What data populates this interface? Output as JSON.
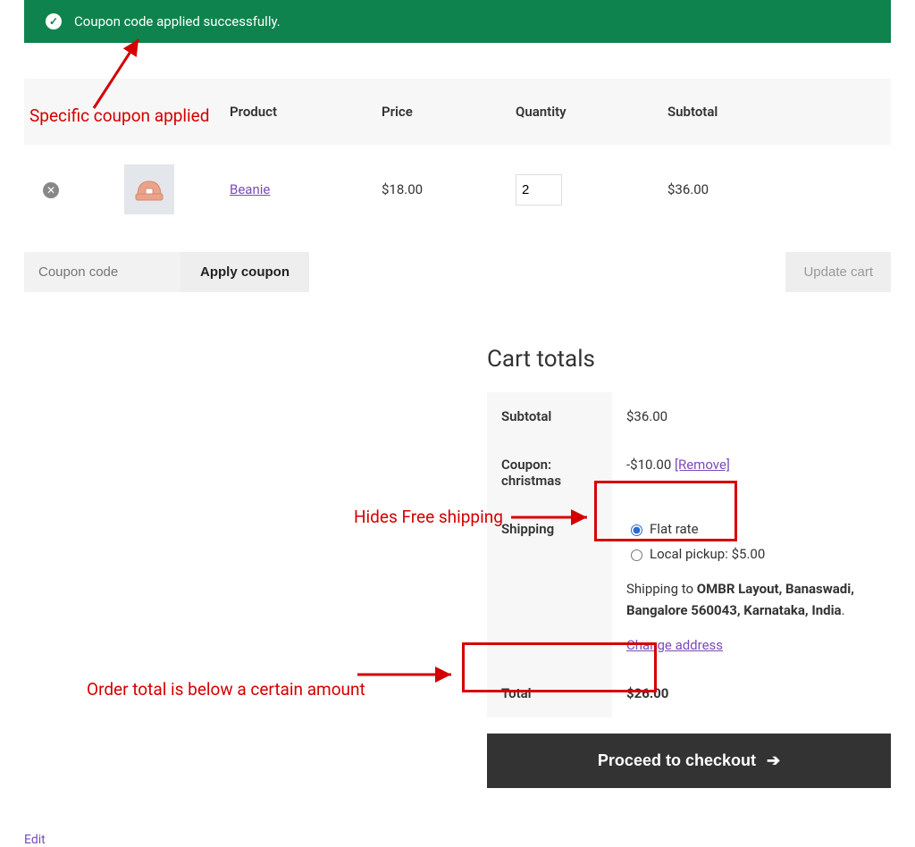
{
  "notice": {
    "message": "Coupon code applied successfully."
  },
  "cart": {
    "headers": {
      "product": "Product",
      "price": "Price",
      "quantity": "Quantity",
      "subtotal": "Subtotal"
    },
    "items": [
      {
        "product_name": "Beanie",
        "price": "$18.00",
        "quantity": "2",
        "subtotal": "$36.00"
      }
    ],
    "coupon_placeholder": "Coupon code",
    "apply_coupon_label": "Apply coupon",
    "update_cart_label": "Update cart"
  },
  "totals": {
    "heading": "Cart totals",
    "subtotal_label": "Subtotal",
    "subtotal_value": "$36.00",
    "coupon_label_prefix": "Coupon:",
    "coupon_code": "christmas",
    "coupon_discount": "-$10.00",
    "remove_coupon_label": "[Remove]",
    "shipping_label": "Shipping",
    "shipping_options": [
      {
        "label": "Flat rate",
        "selected": true
      },
      {
        "label": "Local pickup: $5.00",
        "selected": false
      }
    ],
    "shipping_to_prefix": "Shipping to ",
    "shipping_address": "OMBR Layout, Banaswadi, Bangalore 560043, Karnataka, India",
    "change_address_label": "Change address",
    "total_label": "Total",
    "total_value": "$26.00",
    "checkout_label": "Proceed to checkout"
  },
  "footer": {
    "edit_label": "Edit"
  },
  "annotations": {
    "a1": "Specific coupon applied",
    "a2": "Hides Free shipping",
    "a3": "Order total is below a certain amount"
  }
}
